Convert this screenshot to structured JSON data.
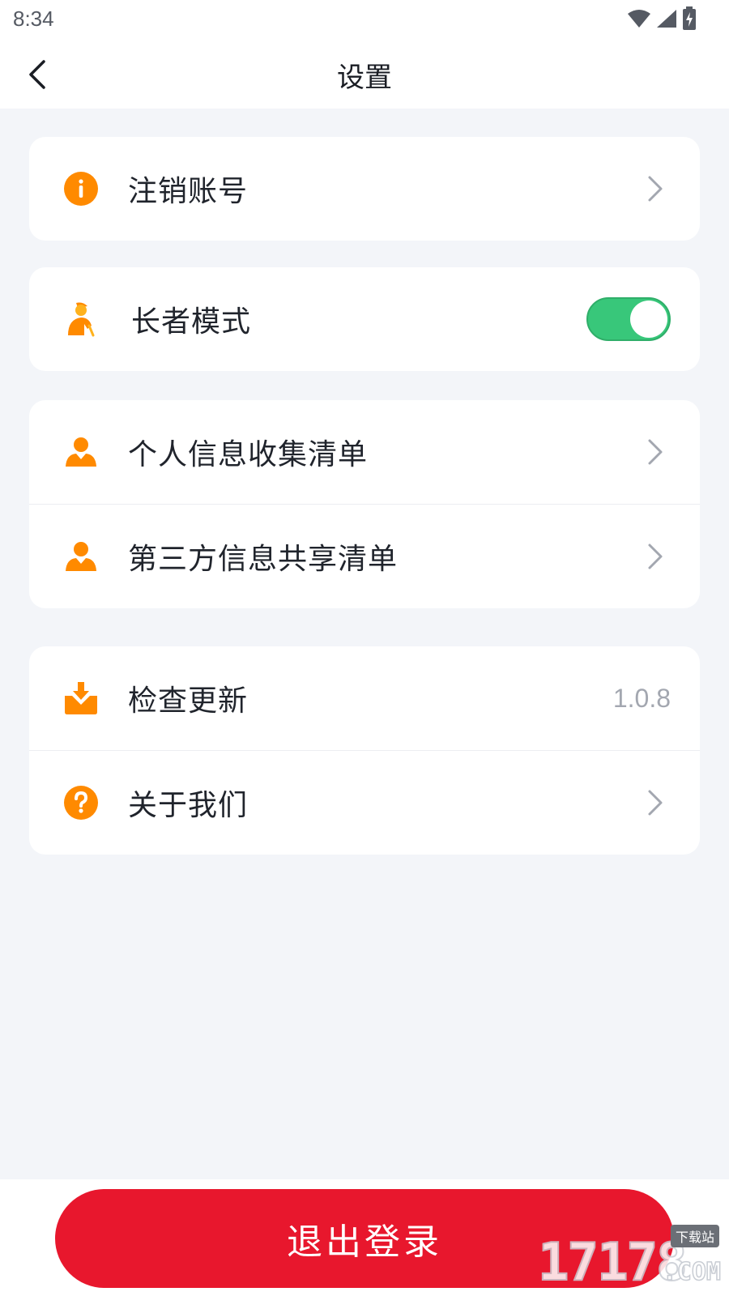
{
  "status_bar": {
    "time": "8:34",
    "icons": [
      "wifi-icon",
      "signal-icon",
      "battery-charging-icon"
    ]
  },
  "header": {
    "title": "设置",
    "back_icon": "chevron-left-icon"
  },
  "sections": {
    "account": {
      "deactivate": {
        "label": "注销账号",
        "icon": "info-circle-icon"
      }
    },
    "elder": {
      "elder_mode": {
        "label": "长者模式",
        "icon": "elder-icon",
        "enabled": true
      }
    },
    "privacy": {
      "personal_info": {
        "label": "个人信息收集清单",
        "icon": "person-icon"
      },
      "third_party": {
        "label": "第三方信息共享清单",
        "icon": "person-icon"
      }
    },
    "app": {
      "check_update": {
        "label": "检查更新",
        "icon": "download-tray-icon",
        "value": "1.0.8"
      },
      "about": {
        "label": "关于我们",
        "icon": "question-circle-icon"
      }
    }
  },
  "footer": {
    "logout_label": "退出登录"
  },
  "watermark": {
    "digits": "17178",
    "badge": "下载站",
    "suffix": ".COM"
  },
  "colors": {
    "accent": "#ff8a00",
    "toggle_on": "#38c77a",
    "logout": "#e8172d",
    "background": "#f3f5f9"
  }
}
